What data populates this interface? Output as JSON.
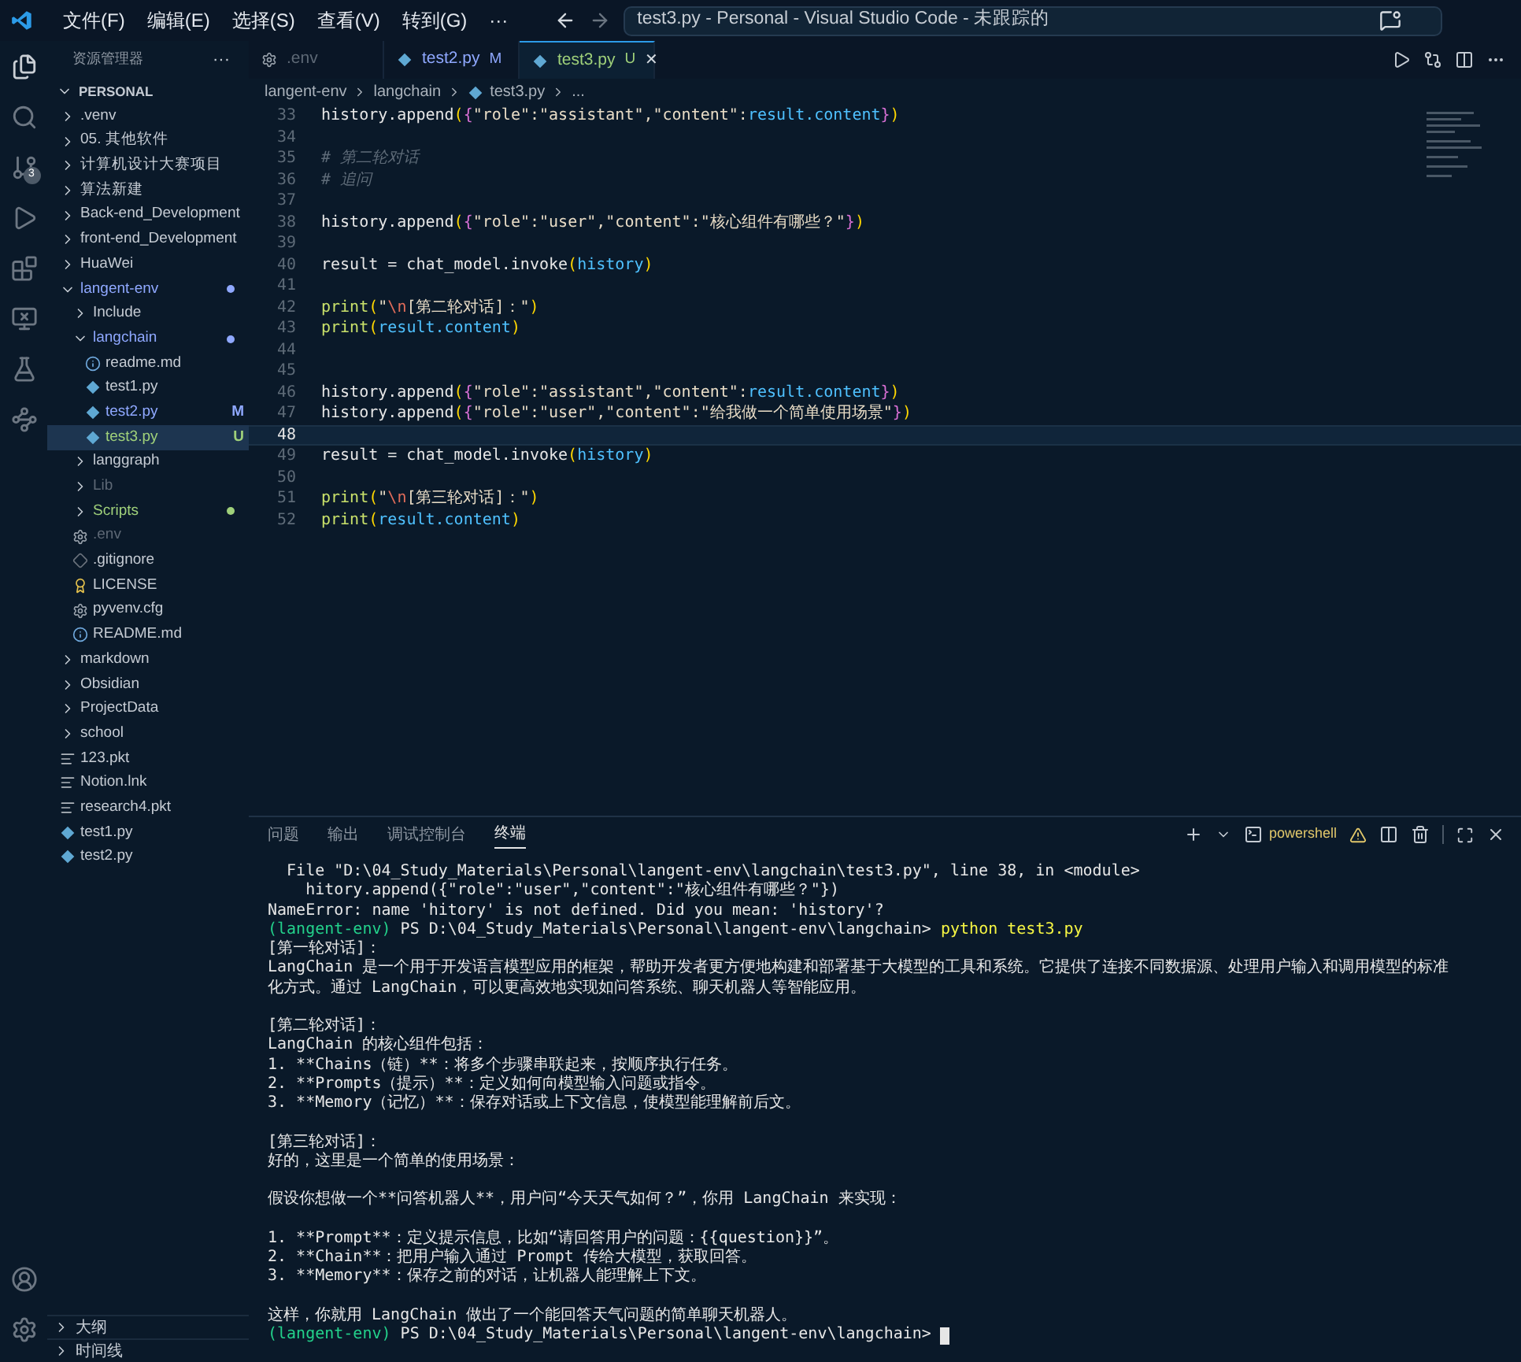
{
  "menu": [
    "文件(F)",
    "编辑(E)",
    "选择(S)",
    "查看(V)",
    "转到(G)",
    "···"
  ],
  "command_center": {
    "text": "test3.py - Personal - Visual Studio Code - 未跟踪的"
  },
  "activity_bar": {
    "source_control_badge": "3"
  },
  "sidebar": {
    "title": "资源管理器",
    "more": "···",
    "root": "PERSONAL",
    "tree": [
      {
        "name": ".venv",
        "kind": "folder",
        "expanded": false,
        "dot": false,
        "selected": false
      },
      {
        "name": "05. 其他软件",
        "kind": "folder",
        "expanded": false,
        "dot": false,
        "selected": false
      },
      {
        "name": "计算机设计大赛项目",
        "kind": "folder",
        "expanded": false,
        "dot": false,
        "selected": false
      },
      {
        "name": "算法新建",
        "kind": "folder",
        "expanded": false,
        "dot": false,
        "selected": false
      },
      {
        "name": "Back-end_Development",
        "kind": "folder",
        "expanded": false,
        "dot": false,
        "selected": false
      },
      {
        "name": "front-end_Development",
        "kind": "folder",
        "expanded": false,
        "dot": false,
        "selected": false
      },
      {
        "name": "HuaWei",
        "kind": "folder",
        "expanded": false,
        "dot": false,
        "selected": false
      },
      {
        "name": "langent-env",
        "kind": "folder",
        "expanded": true,
        "color": "#8fa8ff",
        "dot": true,
        "selected": false,
        "children": [
          {
            "name": "Include",
            "kind": "folder",
            "expanded": false,
            "dot": false,
            "selected": false
          },
          {
            "name": "langchain",
            "kind": "folder",
            "expanded": true,
            "color": "#8fa8ff",
            "dot": true,
            "selected": false,
            "children": [
              {
                "name": "readme.md",
                "kind": "info",
                "selected": false
              },
              {
                "name": "test1.py",
                "kind": "python",
                "selected": false
              },
              {
                "name": "test2.py",
                "kind": "python",
                "color": "#8fa8ff",
                "badge": "M",
                "selected": false
              },
              {
                "name": "test3.py",
                "kind": "python",
                "color": "#9fd07a",
                "badge": "U",
                "selected": true
              }
            ]
          },
          {
            "name": "langgraph",
            "kind": "folder",
            "expanded": false,
            "dot": false,
            "selected": false
          },
          {
            "name": "Lib",
            "kind": "folder",
            "expanded": false,
            "color": "#5d6875",
            "dot": false,
            "selected": false
          },
          {
            "name": "Scripts",
            "kind": "folder",
            "expanded": false,
            "color": "#9fd07a",
            "dot": true,
            "selected": false
          },
          {
            "name": ".env",
            "kind": "gear",
            "color": "#5d6875",
            "selected": false
          },
          {
            "name": ".gitignore",
            "kind": "git",
            "selected": false
          },
          {
            "name": "LICENSE",
            "kind": "license",
            "selected": false
          },
          {
            "name": "pyvenv.cfg",
            "kind": "gear",
            "selected": false
          },
          {
            "name": "README.md",
            "kind": "info",
            "selected": false
          }
        ]
      },
      {
        "name": "markdown",
        "kind": "folder",
        "expanded": false,
        "dot": false,
        "selected": false
      },
      {
        "name": "Obsidian",
        "kind": "folder",
        "expanded": false,
        "dot": false,
        "selected": false
      },
      {
        "name": "ProjectData",
        "kind": "folder",
        "expanded": false,
        "dot": false,
        "selected": false
      },
      {
        "name": "school",
        "kind": "folder",
        "expanded": false,
        "dot": false,
        "selected": false
      },
      {
        "name": "123.pkt",
        "kind": "lines",
        "selected": false
      },
      {
        "name": "Notion.lnk",
        "kind": "lines",
        "selected": false
      },
      {
        "name": "research4.pkt",
        "kind": "lines",
        "selected": false
      },
      {
        "name": "test1.py",
        "kind": "python",
        "selected": false
      },
      {
        "name": "test2.py",
        "kind": "python",
        "selected": false
      }
    ],
    "sections": [
      {
        "label": "大纲",
        "expanded": false
      },
      {
        "label": "时间线",
        "expanded": false
      }
    ]
  },
  "tabs": [
    {
      "label": ".env",
      "kind": "gear",
      "color": "#5d6875",
      "selected": false
    },
    {
      "label": "test2.py",
      "kind": "python",
      "color": "#8fa8ff",
      "badge": "M",
      "selected": false
    },
    {
      "label": "test3.py",
      "kind": "python",
      "color": "#9fd07a",
      "badge": "U",
      "selected": true,
      "close": "✕"
    }
  ],
  "breadcrumbs": [
    "langent-env",
    "langchain",
    "test3.py",
    "..."
  ],
  "code": [
    {
      "num": "33",
      "current": false,
      "tokens": [
        {
          "text": "history.append",
          "kind": "t"
        },
        {
          "text": "(",
          "kind": "p1"
        },
        {
          "text": "{",
          "kind": "p2"
        },
        {
          "text": "\"role\":\"assistant\",\"content\":",
          "kind": "s"
        },
        {
          "text": "result.content",
          "kind": "v"
        },
        {
          "text": "}",
          "kind": "p2"
        },
        {
          "text": ")",
          "kind": "p1"
        }
      ]
    },
    {
      "num": "34",
      "current": false
    },
    {
      "num": "35",
      "current": false,
      "tokens": [
        {
          "text": "# 第二轮对话",
          "kind": "c"
        }
      ]
    },
    {
      "num": "36",
      "current": false,
      "tokens": [
        {
          "text": "# 追问",
          "kind": "c"
        }
      ]
    },
    {
      "num": "37",
      "current": false
    },
    {
      "num": "38",
      "current": false,
      "tokens": [
        {
          "text": "history.append",
          "kind": "t"
        },
        {
          "text": "(",
          "kind": "p1"
        },
        {
          "text": "{",
          "kind": "p2"
        },
        {
          "text": "\"role\":\"user\",\"content\":\"核心组件有哪些？\"",
          "kind": "s"
        },
        {
          "text": "}",
          "kind": "p2"
        },
        {
          "text": ")",
          "kind": "p1"
        }
      ]
    },
    {
      "num": "39",
      "current": false
    },
    {
      "num": "40",
      "current": false,
      "tokens": [
        {
          "text": "result = chat_model.invoke",
          "kind": "t"
        },
        {
          "text": "(",
          "kind": "p1"
        },
        {
          "text": "history",
          "kind": "v"
        },
        {
          "text": ")",
          "kind": "p1"
        }
      ]
    },
    {
      "num": "41",
      "current": false
    },
    {
      "num": "42",
      "current": false,
      "tokens": [
        {
          "text": "print",
          "kind": "f"
        },
        {
          "text": "(",
          "kind": "p1"
        },
        {
          "text": "\"",
          "kind": "s"
        },
        {
          "text": "\\n",
          "kind": "e"
        },
        {
          "text": "[第二轮对话]：\"",
          "kind": "s"
        },
        {
          "text": ")",
          "kind": "p1"
        }
      ]
    },
    {
      "num": "43",
      "current": false,
      "tokens": [
        {
          "text": "print",
          "kind": "f"
        },
        {
          "text": "(",
          "kind": "p1"
        },
        {
          "text": "result.content",
          "kind": "v"
        },
        {
          "text": ")",
          "kind": "p1"
        }
      ]
    },
    {
      "num": "44",
      "current": false
    },
    {
      "num": "45",
      "current": false
    },
    {
      "num": "46",
      "current": false,
      "tokens": [
        {
          "text": "history.append",
          "kind": "t"
        },
        {
          "text": "(",
          "kind": "p1"
        },
        {
          "text": "{",
          "kind": "p2"
        },
        {
          "text": "\"role\":\"assistant\",\"content\":",
          "kind": "s"
        },
        {
          "text": "result.content",
          "kind": "v"
        },
        {
          "text": "}",
          "kind": "p2"
        },
        {
          "text": ")",
          "kind": "p1"
        }
      ]
    },
    {
      "num": "47",
      "current": false,
      "tokens": [
        {
          "text": "history.append",
          "kind": "t"
        },
        {
          "text": "(",
          "kind": "p1"
        },
        {
          "text": "{",
          "kind": "p2"
        },
        {
          "text": "\"role\":\"user\",\"content\":\"给我做一个简单使用场景\"",
          "kind": "s"
        },
        {
          "text": "}",
          "kind": "p2"
        },
        {
          "text": ")",
          "kind": "p1"
        }
      ]
    },
    {
      "num": "48",
      "current": true
    },
    {
      "num": "49",
      "current": false,
      "tokens": [
        {
          "text": "result = chat_model.invoke",
          "kind": "t"
        },
        {
          "text": "(",
          "kind": "p1"
        },
        {
          "text": "history",
          "kind": "v"
        },
        {
          "text": ")",
          "kind": "p1"
        }
      ]
    },
    {
      "num": "50",
      "current": false
    },
    {
      "num": "51",
      "current": false,
      "tokens": [
        {
          "text": "print",
          "kind": "f"
        },
        {
          "text": "(",
          "kind": "p1"
        },
        {
          "text": "\"",
          "kind": "s"
        },
        {
          "text": "\\n",
          "kind": "e"
        },
        {
          "text": "[第三轮对话]：\"",
          "kind": "s"
        },
        {
          "text": ")",
          "kind": "p1"
        }
      ]
    },
    {
      "num": "52",
      "current": false,
      "tokens": [
        {
          "text": "print",
          "kind": "f"
        },
        {
          "text": "(",
          "kind": "p1"
        },
        {
          "text": "result.content",
          "kind": "v"
        },
        {
          "text": ")",
          "kind": "p1"
        }
      ]
    }
  ],
  "panel": {
    "tabs": [
      {
        "label": "问题",
        "selected": false
      },
      {
        "label": "输出",
        "selected": false
      },
      {
        "label": "调试控制台",
        "selected": false
      },
      {
        "label": "终端",
        "selected": true
      }
    ],
    "shell": "powershell",
    "terminal": {
      "cursor": true,
      "lines": [
        {
          "kind": "text",
          "segments": [
            {
              "text": "  File \"D:\\04_Study_Materials\\Personal\\langent-env\\langchain\\test3.py\", line 38, in <module>",
              "kind": "out"
            }
          ]
        },
        {
          "kind": "text",
          "segments": [
            {
              "text": "    hitory.append({\"role\":\"user\",\"content\":\"核心组件有哪些？\"})",
              "kind": "out"
            }
          ]
        },
        {
          "kind": "text",
          "segments": [
            {
              "text": "NameError: name 'hitory' is not defined. Did you mean: 'history'?",
              "kind": "out"
            }
          ]
        },
        {
          "kind": "text",
          "segments": [
            {
              "text": "(langent-env)",
              "kind": "env"
            },
            {
              "text": " PS D:\\04_Study_Materials\\Personal\\langent-env\\langchain> ",
              "kind": "out"
            },
            {
              "text": "python test3.py",
              "kind": "cmd"
            }
          ]
        },
        {
          "kind": "text",
          "segments": [
            {
              "text": "[第一轮对话]：",
              "kind": "out"
            }
          ]
        },
        {
          "kind": "text",
          "segments": [
            {
              "text": "LangChain 是一个用于开发语言模型应用的框架，帮助开发者更方便地构建和部署基于大模型的工具和系统。它提供了连接不同数据源、处理用户输入和调用模型的标准",
              "kind": "out"
            }
          ]
        },
        {
          "kind": "text",
          "segments": [
            {
              "text": "化方式。通过 LangChain，可以更高效地实现如问答系统、聊天机器人等智能应用。",
              "kind": "out"
            }
          ]
        },
        {
          "kind": "blank"
        },
        {
          "kind": "text",
          "segments": [
            {
              "text": "[第二轮对话]：",
              "kind": "out"
            }
          ]
        },
        {
          "kind": "text",
          "segments": [
            {
              "text": "LangChain 的核心组件包括：",
              "kind": "out"
            }
          ]
        },
        {
          "kind": "text",
          "segments": [
            {
              "text": "1. **Chains（链）**：将多个步骤串联起来，按顺序执行任务。",
              "kind": "out"
            }
          ]
        },
        {
          "kind": "text",
          "segments": [
            {
              "text": "2. **Prompts（提示）**：定义如何向模型输入问题或指令。",
              "kind": "out"
            }
          ]
        },
        {
          "kind": "text",
          "segments": [
            {
              "text": "3. **Memory（记忆）**：保存对话或上下文信息，使模型能理解前后文。",
              "kind": "out"
            }
          ]
        },
        {
          "kind": "blank"
        },
        {
          "kind": "text",
          "segments": [
            {
              "text": "[第三轮对话]：",
              "kind": "out"
            }
          ]
        },
        {
          "kind": "text",
          "segments": [
            {
              "text": "好的，这里是一个简单的使用场景：",
              "kind": "out"
            }
          ]
        },
        {
          "kind": "blank"
        },
        {
          "kind": "text",
          "segments": [
            {
              "text": "假设你想做一个**问答机器人**，用户问“今天天气如何？”，你用 LangChain 来实现：",
              "kind": "out"
            }
          ]
        },
        {
          "kind": "blank"
        },
        {
          "kind": "text",
          "segments": [
            {
              "text": "1. **Prompt**：定义提示信息，比如“请回答用户的问题：{{question}}”。",
              "kind": "out"
            }
          ]
        },
        {
          "kind": "text",
          "segments": [
            {
              "text": "2. **Chain**：把用户输入通过 Prompt 传给大模型，获取回答。",
              "kind": "out"
            }
          ]
        },
        {
          "kind": "text",
          "segments": [
            {
              "text": "3. **Memory**：保存之前的对话，让机器人能理解上下文。",
              "kind": "out"
            }
          ]
        },
        {
          "kind": "blank"
        },
        {
          "kind": "text",
          "segments": [
            {
              "text": "这样，你就用 LangChain 做出了一个能回答天气问题的简单聊天机器人。",
              "kind": "out"
            }
          ]
        },
        {
          "kind": "text",
          "segments": [
            {
              "text": "(langent-env)",
              "kind": "env"
            },
            {
              "text": " PS D:\\04_Study_Materials\\Personal\\langent-env\\langchain> ",
              "kind": "out"
            }
          ]
        }
      ]
    }
  }
}
